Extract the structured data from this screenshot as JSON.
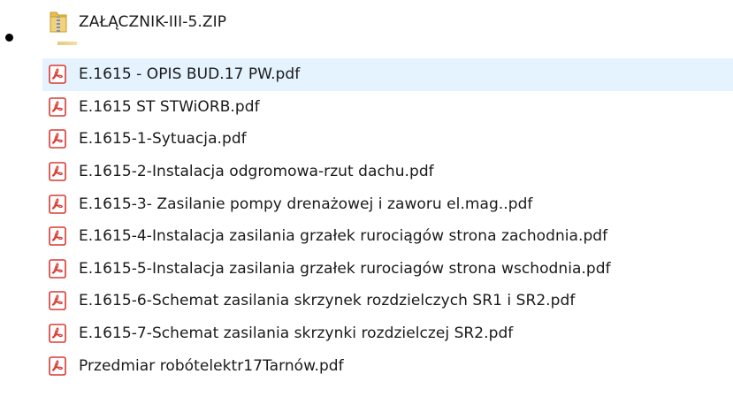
{
  "zip_item": {
    "name": "ZAŁĄCZNIK-III-5.ZIP",
    "icon": "zip-folder-icon"
  },
  "files": [
    {
      "name": "E.1615 - OPIS BUD.17 PW.pdf",
      "icon": "pdf-icon",
      "selected": true
    },
    {
      "name": "E.1615 ST STWiORB.pdf",
      "icon": "pdf-icon"
    },
    {
      "name": "E.1615-1-Sytuacja.pdf",
      "icon": "pdf-icon"
    },
    {
      "name": "E.1615-2-Instalacja odgromowa-rzut dachu.pdf",
      "icon": "pdf-icon"
    },
    {
      "name": "E.1615-3- Zasilanie pompy drenażowej i zaworu el.mag..pdf",
      "icon": "pdf-icon"
    },
    {
      "name": "E.1615-4-Instalacja zasilania grzałek rurociągów strona zachodnia.pdf",
      "icon": "pdf-icon"
    },
    {
      "name": "E.1615-5-Instalacja zasilania grzałek rurociagów strona wschodnia.pdf",
      "icon": "pdf-icon"
    },
    {
      "name": "E.1615-6-Schemat zasilania skrzynek rozdzielczych SR1 i SR2.pdf",
      "icon": "pdf-icon"
    },
    {
      "name": "E.1615-7-Schemat zasilania skrzynki rozdzielczej SR2.pdf",
      "icon": "pdf-icon"
    },
    {
      "name": "Przedmiar robótelektr17Tarnów.pdf",
      "icon": "pdf-icon"
    }
  ],
  "colors": {
    "selection": "#e5f3ff",
    "pdf_red": "#d93a32",
    "zip_yellow": "#e8bf4f"
  }
}
